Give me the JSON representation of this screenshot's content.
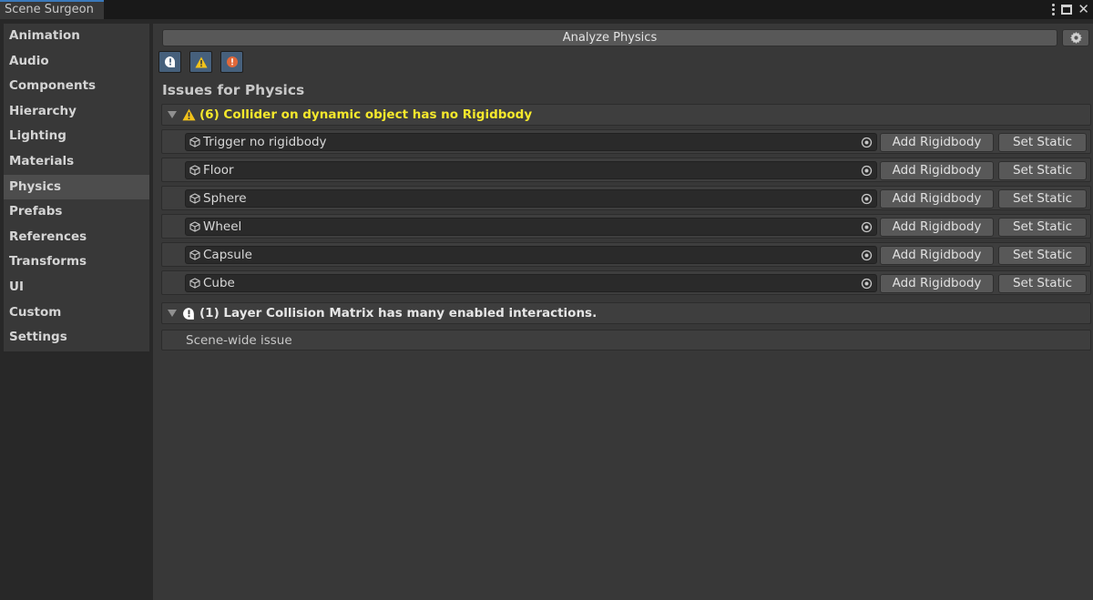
{
  "window": {
    "tab_title": "Scene Surgeon"
  },
  "sidebar": {
    "items": [
      {
        "label": "Animation"
      },
      {
        "label": "Audio"
      },
      {
        "label": "Components"
      },
      {
        "label": "Hierarchy"
      },
      {
        "label": "Lighting"
      },
      {
        "label": "Materials"
      },
      {
        "label": "Physics",
        "active": true
      },
      {
        "label": "Prefabs"
      },
      {
        "label": "References"
      },
      {
        "label": "Transforms"
      },
      {
        "label": "UI"
      },
      {
        "label": "Custom"
      },
      {
        "label": "Settings"
      }
    ]
  },
  "toolbar": {
    "analyze_label": "Analyze Physics",
    "settings_icon": "gear-icon"
  },
  "filters": [
    {
      "icon": "info-icon",
      "color": "#ffffff"
    },
    {
      "icon": "warning-icon",
      "color": "#f2c21a"
    },
    {
      "icon": "error-icon",
      "color": "#e0683a"
    }
  ],
  "main": {
    "section_title": "Issues for Physics",
    "groups": [
      {
        "header": "(6) Collider on dynamic object has no Rigidbody",
        "severity": "warning",
        "rows": [
          {
            "object": "Trigger no rigidbody",
            "add_label": "Add Rigidbody",
            "static_label": "Set Static"
          },
          {
            "object": "Floor",
            "add_label": "Add Rigidbody",
            "static_label": "Set Static"
          },
          {
            "object": "Sphere",
            "add_label": "Add Rigidbody",
            "static_label": "Set Static"
          },
          {
            "object": "Wheel",
            "add_label": "Add Rigidbody",
            "static_label": "Set Static"
          },
          {
            "object": "Capsule",
            "add_label": "Add Rigidbody",
            "static_label": "Set Static"
          },
          {
            "object": "Cube",
            "add_label": "Add Rigidbody",
            "static_label": "Set Static"
          }
        ]
      },
      {
        "header": "(1) Layer Collision Matrix has many enabled interactions.",
        "severity": "info",
        "scene_text": "Scene-wide issue"
      }
    ]
  },
  "colors": {
    "warning_text": "#f5e82c",
    "accent": "#3a79bb"
  }
}
